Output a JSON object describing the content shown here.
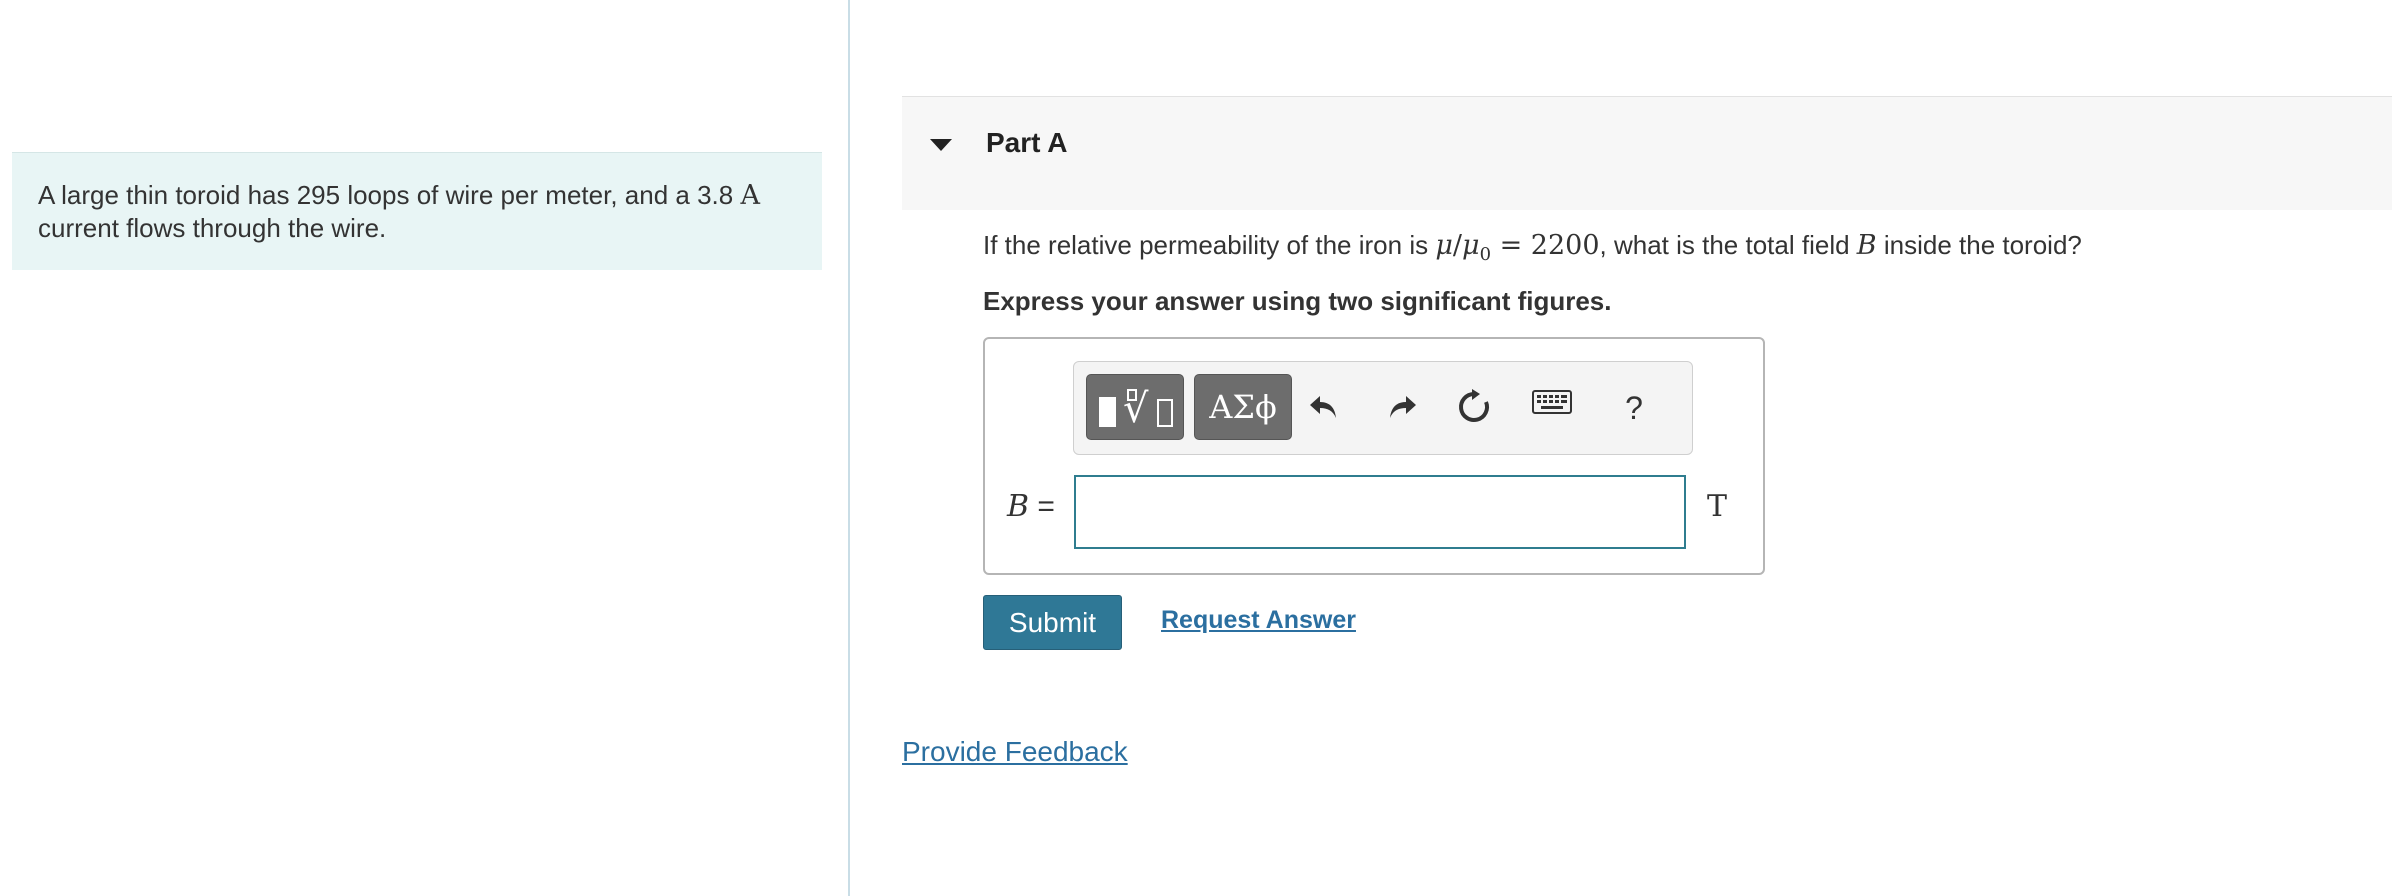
{
  "problem": {
    "text_before": "A large thin toroid has 295 loops of wire per meter, and a 3.8 ",
    "unit_current": "A",
    "text_after": "current flows through the wire."
  },
  "part": {
    "title": "Part A",
    "question": {
      "prefix": "If the relative permeability of the iron is ",
      "mu": "μ",
      "slash": "/",
      "mu0": "μ",
      "mu0_sub": "0",
      "equals": " = 2200",
      "middle": ", what is the total field ",
      "field_var": "B",
      "suffix": " inside the toroid?"
    },
    "instruction": "Express your answer using two significant figures."
  },
  "toolbar": {
    "templates_icon": "templates-icon",
    "symbols_label": "ΑΣϕ",
    "undo_icon": "undo-icon",
    "redo_icon": "redo-icon",
    "reset_icon": "reset-icon",
    "keyboard_icon": "keyboard-icon",
    "help_label": "?"
  },
  "answer": {
    "variable": "B",
    "equals": " =",
    "value": "",
    "unit": "T"
  },
  "actions": {
    "submit_label": "Submit",
    "request_answer_label": "Request Answer"
  },
  "footer": {
    "feedback_label": "Provide Feedback"
  },
  "colors": {
    "problem_panel_bg": "#e8f5f5",
    "submit_bg": "#2f7896",
    "link": "#2b6fa0",
    "input_border": "#2f7d8f"
  }
}
